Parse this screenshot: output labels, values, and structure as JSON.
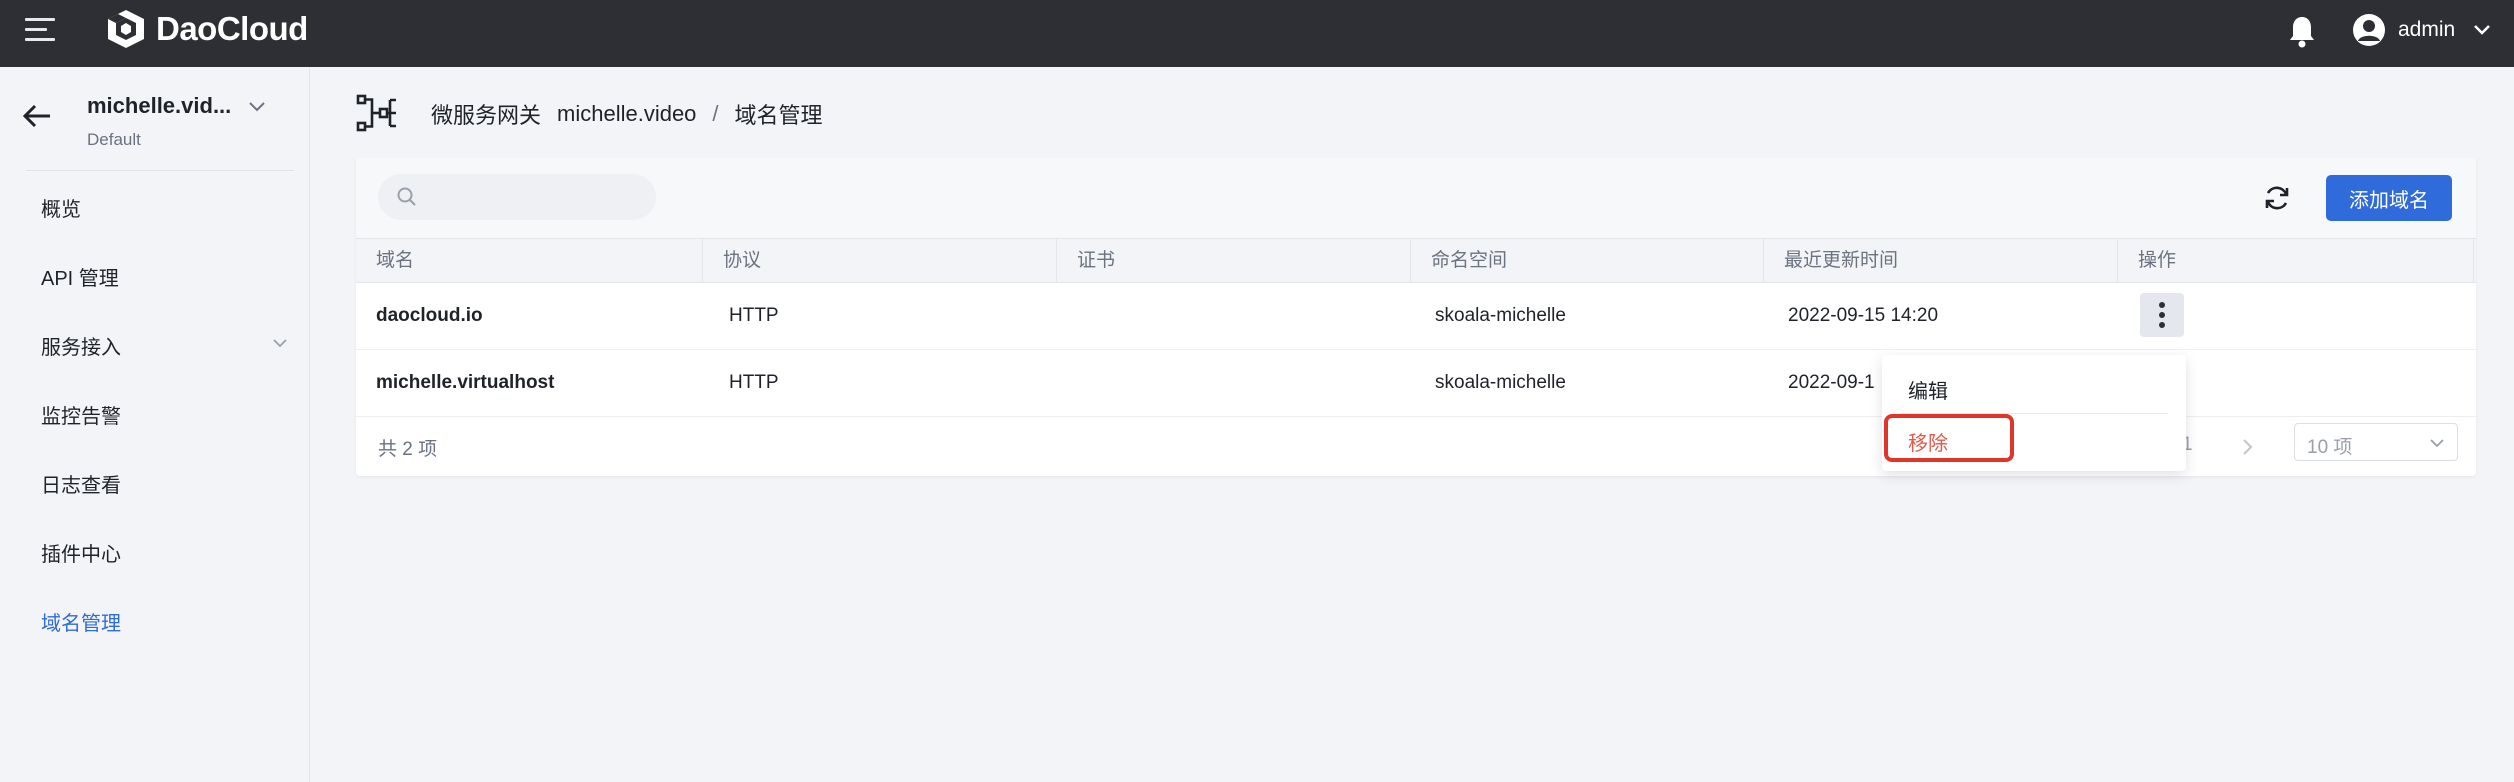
{
  "topbar": {
    "brand": "DaoCloud",
    "user": "admin"
  },
  "sidebar": {
    "workspace": "michelle.vid...",
    "workspace_sub": "Default",
    "items": [
      {
        "label": "概览"
      },
      {
        "label": "API 管理"
      },
      {
        "label": "服务接入"
      },
      {
        "label": "监控告警"
      },
      {
        "label": "日志查看"
      },
      {
        "label": "插件中心"
      },
      {
        "label": "域名管理"
      }
    ]
  },
  "breadcrumb": {
    "root": "微服务网关",
    "instance": "michelle.video",
    "separator": "/",
    "current": "域名管理"
  },
  "toolbar": {
    "search_placeholder": "",
    "add_label": "添加域名"
  },
  "table": {
    "headers": [
      "域名",
      "协议",
      "证书",
      "命名空间",
      "最近更新时间",
      "操作"
    ],
    "rows": [
      {
        "domain": "daocloud.io",
        "protocol": "HTTP",
        "cert": "",
        "namespace": "skoala-michelle",
        "updated": "2022-09-15 14:20"
      },
      {
        "domain": "michelle.virtualhost",
        "protocol": "HTTP",
        "cert": "",
        "namespace": "skoala-michelle",
        "updated": "2022-09-1"
      }
    ]
  },
  "footer": {
    "total": "共 2 项",
    "page": "1",
    "page_size": "10 项"
  },
  "menu": {
    "edit": "编辑",
    "remove": "移除"
  },
  "colors": {
    "topbar": "#2d2f35",
    "accent": "#2f6bdb",
    "danger": "#e05a4a",
    "highlight": "#e0352b"
  }
}
